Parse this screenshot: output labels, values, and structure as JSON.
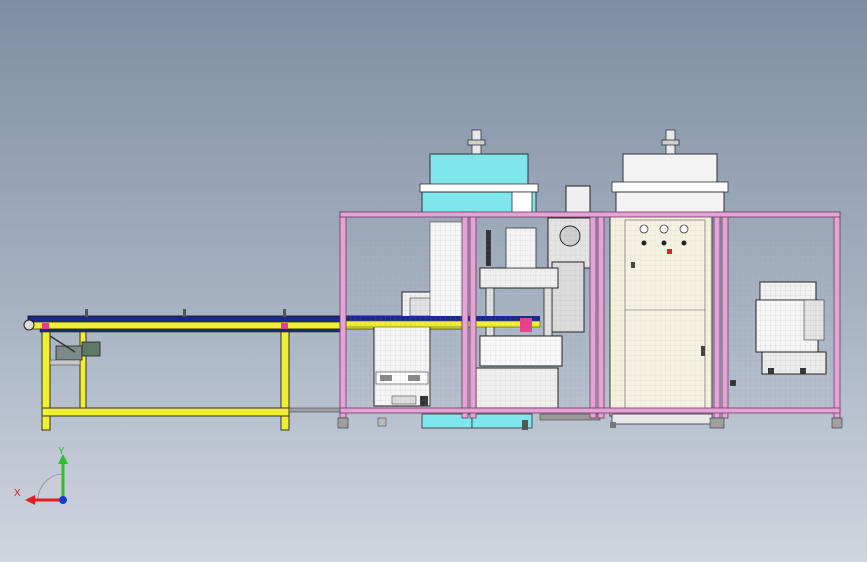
{
  "viewport": {
    "background_top": "#7f8ea3",
    "background_bottom": "#d0d6df"
  },
  "model": {
    "frame_color": "#e6a3d6",
    "conveyor_frame_color": "#f2ee32",
    "belt_color": "#1b2a8a",
    "machine_top_left_color": "#7fe6ec",
    "machine_top_right_color": "#eeeeee",
    "cabinet_color": "#f4f0de",
    "accent_color": "#ee3b8f"
  },
  "triad": {
    "y_label": "Y",
    "x_label": "X",
    "y_color": "#2fbf2f",
    "x_color": "#e02020",
    "z_color": "#1a3ad6"
  }
}
